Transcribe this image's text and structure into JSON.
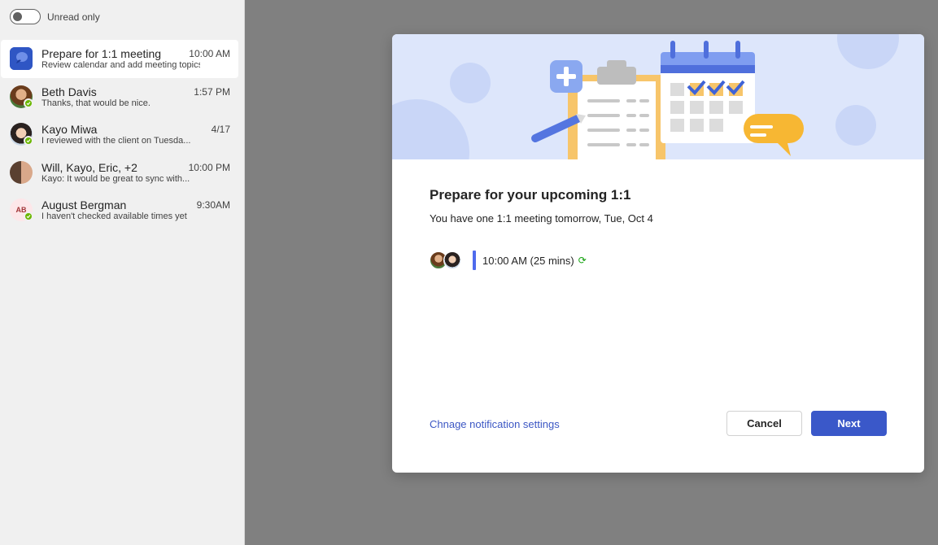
{
  "filter": {
    "label": "Unread only"
  },
  "chats": [
    {
      "name": "Prepare for 1:1 meeting",
      "time": "10:00 AM",
      "preview": "Review calendar and add meeting topics."
    },
    {
      "name": "Beth Davis",
      "time": "1:57 PM",
      "preview": "Thanks, that would be nice."
    },
    {
      "name": "Kayo Miwa",
      "time": "4/17",
      "preview": "I reviewed with the client on Tuesda..."
    },
    {
      "name": "Will, Kayo, Eric, +2",
      "time": "10:00 PM",
      "preview": "Kayo: It would be great to sync with..."
    },
    {
      "name": "August Bergman",
      "time": "9:30AM",
      "preview": "I haven't checked available times yet",
      "initials": "AB"
    }
  ],
  "dialog": {
    "title": "Prepare for your upcoming 1:1",
    "subtitle": "You have one 1:1 meeting tomorrow, Tue, Oct 4",
    "meeting_time": "10:00 AM (25 mins)",
    "settings_link": "Chnage notification settings",
    "cancel_label": "Cancel",
    "next_label": "Next"
  },
  "colors": {
    "accent": "#3a58c9",
    "presence": "#6bb700",
    "hero_bg": "#dde6fb"
  }
}
